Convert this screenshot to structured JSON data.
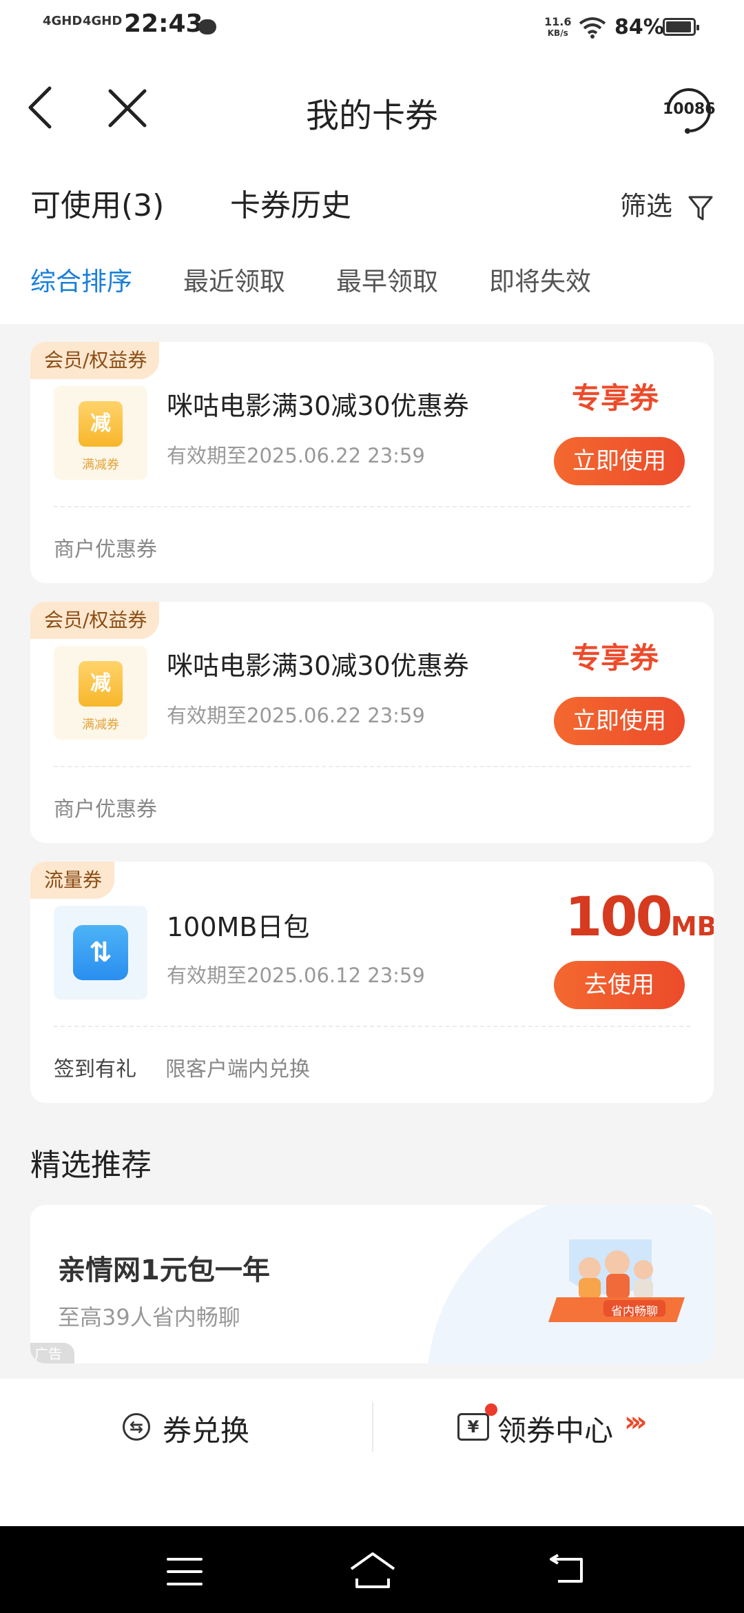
{
  "status_bar": {
    "time": "22:43",
    "signal1": "4GHD",
    "signal2": "4GHD",
    "speed": "11.6",
    "speed_unit": "KB/s",
    "battery": "84%"
  },
  "header": {
    "title": "我的卡券",
    "service_number": "10086",
    "tabs": [
      "可使用(3)",
      "卡券历史"
    ],
    "filter_label": "筛选",
    "sort_options": [
      "综合排序",
      "最近领取",
      "最早领取",
      "即将失效"
    ],
    "active_sort": "综合排序"
  },
  "coupons": [
    {
      "tag": "会员/权益券",
      "icon_text": "减",
      "icon_label": "满减券",
      "title": "咪咕电影满30减30优惠券",
      "valid": "有效期至2025.06.22 23:59",
      "badge": "专享券",
      "button": "立即使用",
      "footer": "商户优惠券"
    },
    {
      "tag": "会员/权益券",
      "icon_text": "减",
      "icon_label": "满减券",
      "title": "咪咕电影满30减30优惠券",
      "valid": "有效期至2025.06.22 23:59",
      "badge": "专享券",
      "button": "立即使用",
      "footer": "商户优惠券"
    },
    {
      "tag": "流量券",
      "icon_text": "⇅",
      "title": "100MB日包",
      "valid": "有效期至2025.06.12 23:59",
      "amount": "100",
      "amount_unit": "MB",
      "button": "去使用",
      "footer_primary": "签到有礼",
      "footer_secondary": "限客户端内兑换"
    }
  ],
  "recommend": {
    "section_title": "精选推荐",
    "title": "亲情网1元包一年",
    "subtitle": "至高39人省内畅聊",
    "ad_label": "广告",
    "illustration_label": "省内畅聊"
  },
  "bottom_bar": {
    "exchange_label": "券兑换",
    "center_label": "领券中心",
    "center_arrows": "›››"
  },
  "colors": {
    "accent_blue": "#1a7fd8",
    "accent_red": "#ec4b2b",
    "tag_bg": "#fde7cf"
  },
  "icons": {
    "back": "back-chevron-icon",
    "close": "close-icon",
    "service": "customer-service-icon",
    "filter": "funnel-icon",
    "exchange": "exchange-icon",
    "ticket": "ticket-icon"
  }
}
